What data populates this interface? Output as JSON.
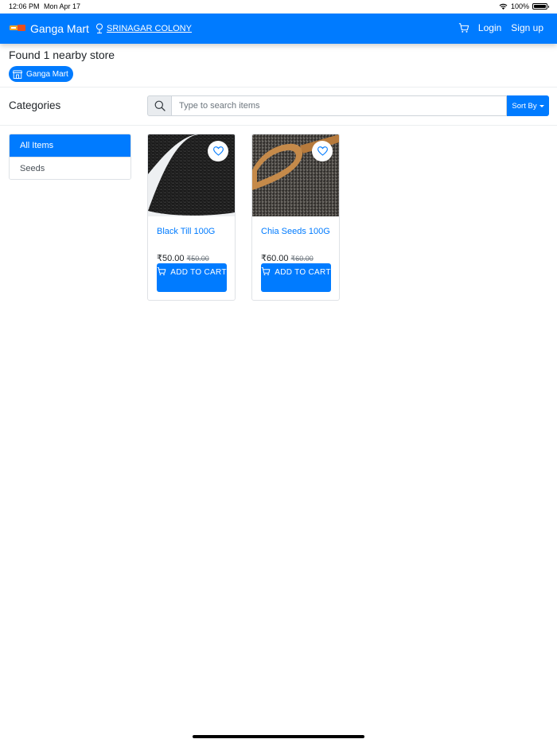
{
  "status_bar": {
    "time": "12:06 PM",
    "date": "Mon Apr 17",
    "battery": "100%"
  },
  "navbar": {
    "brand_name": "Ganga Mart",
    "location": "SRINAGAR COLONY",
    "login": "Login",
    "signup": "Sign up",
    "accent_color": "#007bff"
  },
  "stores": {
    "found_text": "Found 1 nearby store",
    "store_name": "Ganga Mart"
  },
  "categories": {
    "title": "Categories",
    "items": [
      {
        "label": "All Items",
        "active": true
      },
      {
        "label": "Seeds",
        "active": false
      }
    ]
  },
  "search": {
    "placeholder": "Type to search items",
    "sort_label": "Sort By"
  },
  "products": [
    {
      "name": "Black Till 100G",
      "price": "₹50.00",
      "mrp": "₹50.00",
      "button": "ADD TO CART",
      "image": "black sesame seeds heap"
    },
    {
      "name": "Chia Seeds 100G",
      "price": "₹60.00",
      "mrp": "₹60.00",
      "button": "ADD TO CART",
      "image": "chia seeds on wooden spoon"
    }
  ]
}
